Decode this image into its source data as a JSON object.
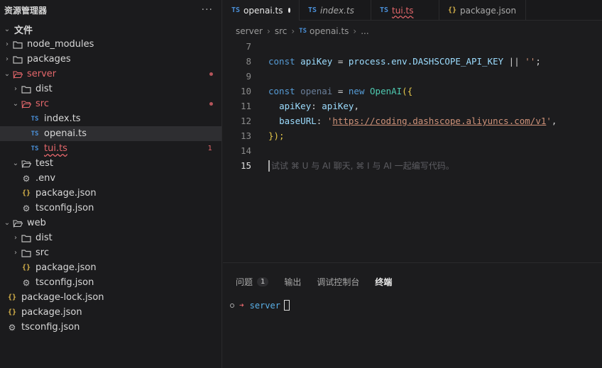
{
  "sidebar": {
    "title": "资源管理器",
    "more": "···",
    "tree": [
      {
        "label": "文件",
        "kind": "root",
        "chevron": "⌄"
      },
      {
        "label": "node_modules",
        "kind": "folder",
        "chevron": "›"
      },
      {
        "label": "packages",
        "kind": "folder",
        "chevron": "›"
      },
      {
        "label": "server",
        "kind": "folder-open",
        "chevron": "⌄"
      },
      {
        "label": "dist",
        "kind": "folder",
        "chevron": "›"
      },
      {
        "label": "src",
        "kind": "folder-open",
        "chevron": "⌄"
      },
      {
        "label": "index.ts",
        "kind": "ts",
        "icon": "TS"
      },
      {
        "label": "openai.ts",
        "kind": "ts",
        "icon": "TS"
      },
      {
        "label": "tui.ts",
        "kind": "ts",
        "icon": "TS",
        "badge": "1"
      },
      {
        "label": "test",
        "kind": "folder-open",
        "chevron": "⌄"
      },
      {
        "label": ".env",
        "kind": "gear"
      },
      {
        "label": "package.json",
        "kind": "json",
        "icon": "{}"
      },
      {
        "label": "tsconfig.json",
        "kind": "gear"
      },
      {
        "label": "web",
        "kind": "folder-open",
        "chevron": "⌄"
      },
      {
        "label": "dist",
        "kind": "folder",
        "chevron": "›"
      },
      {
        "label": "src",
        "kind": "folder",
        "chevron": "›"
      },
      {
        "label": "package.json",
        "kind": "json",
        "icon": "{}"
      },
      {
        "label": "tsconfig.json",
        "kind": "gear"
      },
      {
        "label": "package-lock.json",
        "kind": "json",
        "icon": "{}"
      },
      {
        "label": "package.json",
        "kind": "json",
        "icon": "{}"
      },
      {
        "label": "tsconfig.json",
        "kind": "gear"
      }
    ]
  },
  "tabs": [
    {
      "icon": "TS",
      "label": "openai.ts",
      "active": true,
      "modified": true
    },
    {
      "icon": "TS",
      "label": "index.ts"
    },
    {
      "icon": "TS",
      "label": "tui.ts"
    },
    {
      "icon": "{}",
      "label": "package.json"
    }
  ],
  "breadcrumb": {
    "parts": [
      "server",
      "src"
    ],
    "file_icon": "TS",
    "file": "openai.ts",
    "more": "..."
  },
  "code": {
    "lines": [
      "7",
      "8",
      "9",
      "10",
      "11",
      "12",
      "13",
      "14",
      "15"
    ],
    "current_line": "15",
    "tokens": {
      "const1": "const",
      "apiKey": "apiKey",
      "eq1": " = ",
      "process": "process.env.",
      "envvar": "DASHSCOPE_API_KEY",
      "or": " || ",
      "empty": "''",
      "semi": ";",
      "const2": "const",
      "openai": "openai",
      "eq2": " = ",
      "new": "new",
      "cls": "OpenAI",
      "open": "({",
      "key1": "apiKey",
      "val1": "apiKey",
      "comma": ",",
      "key2": "baseURL",
      "q": "'",
      "url": "https://coding.dashscope.aliyuncs.com/v1",
      "close": "});"
    },
    "hint": "试试 ⌘ U 与 AI 聊天, ⌘ I 与 AI 一起编写代码。"
  },
  "panel": {
    "tabs": [
      {
        "label": "问题",
        "badge": "1"
      },
      {
        "label": "输出"
      },
      {
        "label": "调试控制台"
      },
      {
        "label": "终端",
        "active": true
      }
    ],
    "terminal": {
      "arrow": "➜",
      "dir": "server"
    }
  },
  "colors": {
    "accent": "#4a90d9",
    "error": "#e4676b",
    "json": "#d9b44a"
  }
}
